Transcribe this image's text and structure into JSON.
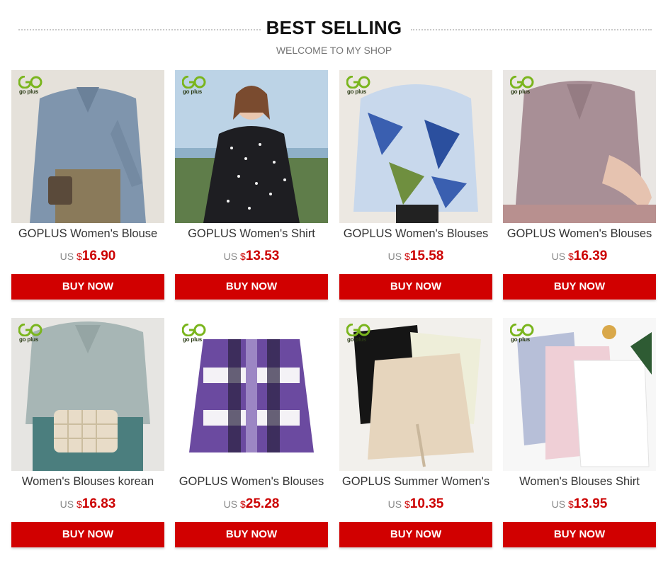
{
  "header": {
    "title": "BEST SELLING",
    "subtitle": "WELCOME TO MY SHOP"
  },
  "brand": {
    "logo_text": "go plus"
  },
  "colors": {
    "accent": "#d10000",
    "price": "#cc0000",
    "logo_green": "#7ab51d"
  },
  "products": [
    {
      "name": "GOPLUS Women's Blouse",
      "currency": "US ",
      "symbol": "$",
      "price": "16.90",
      "button": "BUY NOW",
      "image": "blue-blouse-photo"
    },
    {
      "name": "GOPLUS Women's Shirt",
      "currency": "US ",
      "symbol": "$",
      "price": "13.53",
      "button": "BUY NOW",
      "image": "polka-dot-shirt-photo"
    },
    {
      "name": "GOPLUS Women's Blouses",
      "currency": "US ",
      "symbol": "$",
      "price": "15.58",
      "button": "BUY NOW",
      "image": "print-blouse-photo"
    },
    {
      "name": "GOPLUS Women's Blouses",
      "currency": "US ",
      "symbol": "$",
      "price": "16.39",
      "button": "BUY NOW",
      "image": "satin-blouse-photo"
    },
    {
      "name": "Women's Blouses korean",
      "currency": "US ",
      "symbol": "$",
      "price": "16.83",
      "button": "BUY NOW",
      "image": "sage-blouse-photo"
    },
    {
      "name": "GOPLUS Women's Blouses",
      "currency": "US ",
      "symbol": "$",
      "price": "25.28",
      "button": "BUY NOW",
      "image": "plaid-jacket-photo"
    },
    {
      "name": "GOPLUS Summer Women's",
      "currency": "US ",
      "symbol": "$",
      "price": "10.35",
      "button": "BUY NOW",
      "image": "summer-blouses-photo"
    },
    {
      "name": "Women's Blouses Shirt",
      "currency": "US ",
      "symbol": "$",
      "price": "13.95",
      "button": "BUY NOW",
      "image": "pastel-shirts-photo"
    }
  ]
}
